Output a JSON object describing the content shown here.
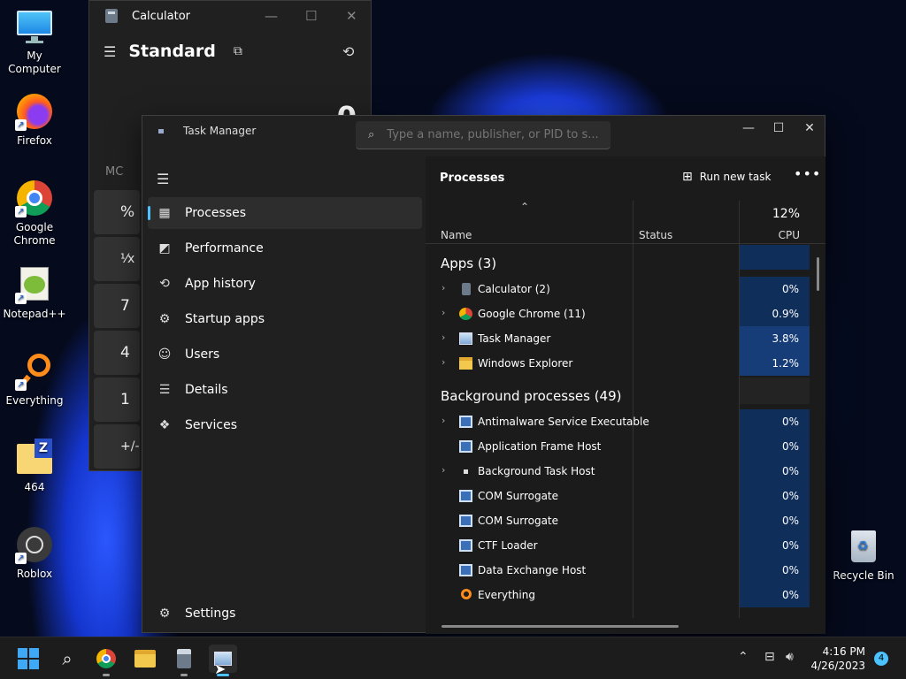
{
  "desktop": {
    "icons": [
      {
        "label": "My Computer",
        "icon": "monitor-icon"
      },
      {
        "label": "Firefox",
        "icon": "firefox-icon"
      },
      {
        "label": "Google Chrome",
        "icon": "chrome-icon"
      },
      {
        "label": "Notepad++",
        "icon": "notepad-plus-plus-icon"
      },
      {
        "label": "Everything",
        "icon": "everything-icon"
      },
      {
        "label": "464",
        "icon": "zip-folder-icon"
      },
      {
        "label": "Roblox",
        "icon": "roblox-icon"
      }
    ],
    "recycle_bin": "Recycle Bin"
  },
  "calculator": {
    "title": "Calculator",
    "mode": "Standard",
    "display": "0",
    "memory_label": "MC",
    "keys": [
      "%",
      "¹⁄x",
      "7",
      "4",
      "1",
      "+/-"
    ]
  },
  "task_manager": {
    "title": "Task Manager",
    "search_placeholder": "Type a name, publisher, or PID to s...",
    "nav": [
      {
        "label": "Processes",
        "icon": "processes-icon",
        "active": true
      },
      {
        "label": "Performance",
        "icon": "performance-icon"
      },
      {
        "label": "App history",
        "icon": "history-icon"
      },
      {
        "label": "Startup apps",
        "icon": "startup-icon"
      },
      {
        "label": "Users",
        "icon": "users-icon"
      },
      {
        "label": "Details",
        "icon": "details-icon"
      },
      {
        "label": "Services",
        "icon": "services-icon"
      }
    ],
    "settings": "Settings",
    "page_title": "Processes",
    "run_new_task": "Run new task",
    "columns": {
      "name": "Name",
      "status": "Status",
      "cpu_percent": "12%",
      "cpu": "CPU"
    },
    "apps_group": "Apps (3)",
    "apps": [
      {
        "name": "Calculator (2)",
        "cpu": "0%",
        "icon": "calculator-icon"
      },
      {
        "name": "Google Chrome (11)",
        "cpu": "0.9%",
        "icon": "chrome-icon"
      },
      {
        "name": "Task Manager",
        "cpu": "3.8%",
        "icon": "task-manager-icon"
      },
      {
        "name": "Windows Explorer",
        "cpu": "1.2%",
        "icon": "folder-icon"
      }
    ],
    "bg_group": "Background processes (49)",
    "background": [
      {
        "name": "Antimalware Service Executable",
        "cpu": "0%",
        "expand": true
      },
      {
        "name": "Application Frame Host",
        "cpu": "0%",
        "expand": false
      },
      {
        "name": "Background Task Host",
        "cpu": "0%",
        "expand": true
      },
      {
        "name": "COM Surrogate",
        "cpu": "0%",
        "expand": false
      },
      {
        "name": "COM Surrogate",
        "cpu": "0%",
        "expand": false
      },
      {
        "name": "CTF Loader",
        "cpu": "0%",
        "expand": false
      },
      {
        "name": "Data Exchange Host",
        "cpu": "0%",
        "expand": false
      },
      {
        "name": "Everything",
        "cpu": "0%",
        "expand": false
      }
    ]
  },
  "taskbar": {
    "time": "4:16 PM",
    "date": "4/26/2023",
    "notifications": "4"
  }
}
